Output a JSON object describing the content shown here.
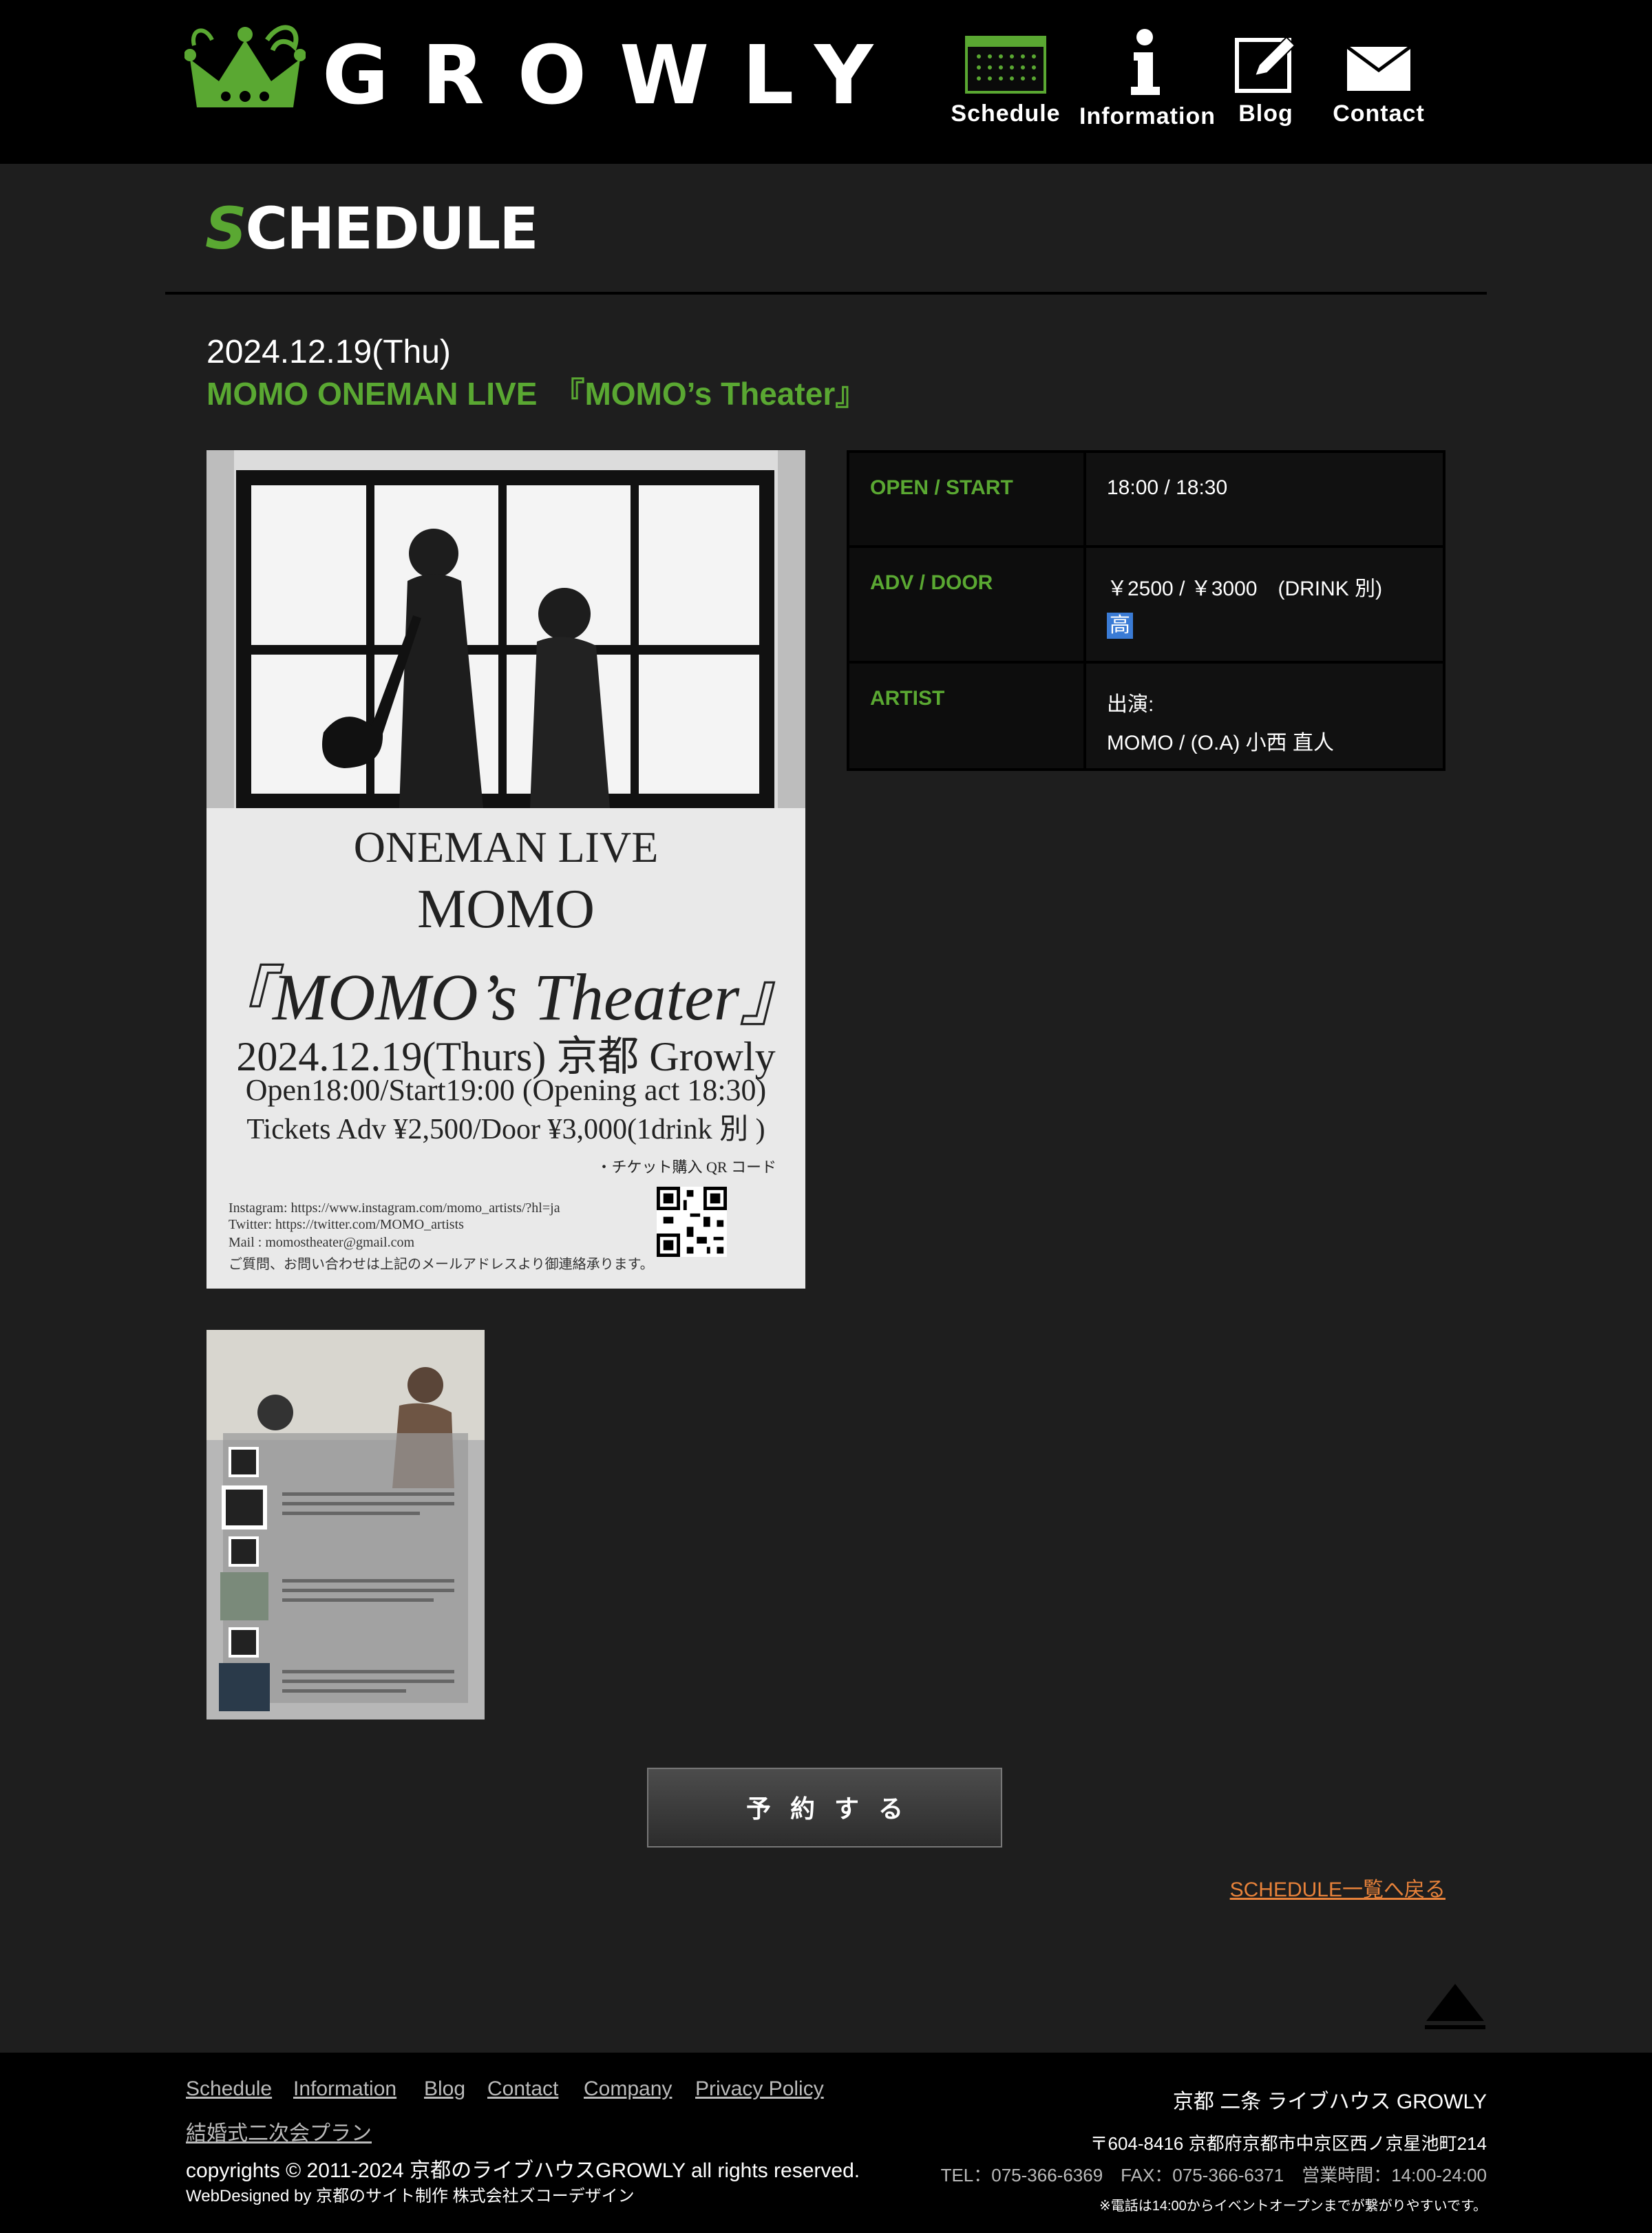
{
  "site": {
    "logo_text": "GROWLY"
  },
  "nav": [
    {
      "label": "Schedule",
      "icon": "calendar-icon"
    },
    {
      "label": "Information",
      "icon": "info-icon"
    },
    {
      "label": "Blog",
      "icon": "pencil-icon"
    },
    {
      "label": "Contact",
      "icon": "envelope-icon"
    }
  ],
  "page": {
    "heading": "SCHEDULE",
    "heading_first": "S",
    "heading_rest": "CHEDULE"
  },
  "event": {
    "date": "2024.12.19(Thu)",
    "title": "MOMO ONEMAN LIVE　『MOMO’s Theater』",
    "details": {
      "open_label": "OPEN / START",
      "open_value": "18:00 / 18:30",
      "price_label": "ADV / DOOR",
      "price_value": "￥2500 / ￥3000　(DRINK 別)",
      "price_badge": "高",
      "artist_label": "ARTIST",
      "artist_line1": "出演:",
      "artist_line2": "MOMO / (O.A) 小西 直人"
    }
  },
  "flyer": {
    "line1": "ONEMAN LIVE",
    "line2": "MOMO",
    "line3": "『MOMO’s Theater』",
    "line4": "2024.12.19(Thurs) 京都 Growly",
    "line5": "Open18:00/Start19:00 (Opening act 18:30)",
    "line6": "Tickets Adv ¥2,500/Door ¥3,000(1drink 別 )",
    "qr_label": "・チケット購入 QR コード",
    "instagram": "Instagram: https://www.instagram.com/momo_artists/?hl=ja",
    "twitter": "Twitter: https://twitter.com/MOMO_artists",
    "mail": "Mail : momostheater@gmail.com",
    "inquiry": "ご質問、お問い合わせは上記のメールアドレスより御連絡承ります。"
  },
  "actions": {
    "reserve": "予約する",
    "back": "SCHEDULE一覧へ戻る"
  },
  "footer": {
    "links": [
      "Schedule",
      "Information",
      "Blog",
      "Contact",
      "Company",
      "Privacy Policy"
    ],
    "wedding": "結婚式二次会プラン",
    "copyright": "copyrights © 2011-2024 京都のライブハウスGROWLY all rights reserved.",
    "webdesigned": "WebDesigned by 京都のサイト制作 株式会社ズコーデザイン",
    "venue": "京都 二条 ライブハウス GROWLY",
    "address": "〒604-8416 京都府京都市中京区西ノ京星池町214",
    "contact": "TEL：075-366-6369　FAX：075-366-6371　営業時間：14:00-24:00",
    "note": "※電話は14:00からイベントオープンまでが繋がりやすいです。"
  },
  "colors": {
    "accent_green": "#5aa832",
    "link_orange": "#e8823a",
    "background": "#1e1e1e"
  }
}
